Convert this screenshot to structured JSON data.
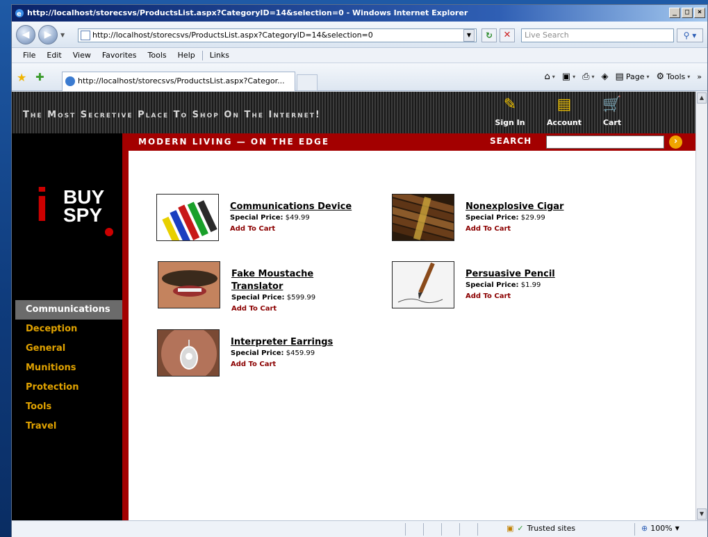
{
  "browser": {
    "title": "http://localhost/storecsvs/ProductsList.aspx?CategoryID=14&selection=0 - Windows Internet Explorer",
    "address": "http://localhost/storecsvs/ProductsList.aspx?CategoryID=14&selection=0",
    "search_placeholder": "Live Search",
    "menu": [
      "File",
      "Edit",
      "View",
      "Favorites",
      "Tools",
      "Help",
      "Links"
    ],
    "tab_label": "http://localhost/storecsvs/ProductsList.aspx?Categor...",
    "commands": {
      "page": "Page",
      "tools": "Tools"
    },
    "status": {
      "zone": "Trusted sites",
      "zoom": "100%"
    }
  },
  "site": {
    "tagline": "The Most Secretive Place To Shop On The Internet!",
    "header_nav": [
      {
        "label": "Sign In",
        "icon": "sign-in-icon"
      },
      {
        "label": "Account",
        "icon": "account-icon"
      },
      {
        "label": "Cart",
        "icon": "cart-icon"
      }
    ],
    "subtitle": "MODERN LIVING — ON THE EDGE",
    "search_label": "SEARCH",
    "logo": {
      "i": "i",
      "buy": "BUY",
      "spy": "SPY"
    },
    "categories": [
      "Communications",
      "Deception",
      "General",
      "Munitions",
      "Protection",
      "Tools",
      "Travel"
    ],
    "active_category": "Communications",
    "price_label": "Special Price:",
    "add_label": "Add To Cart",
    "products": [
      {
        "name": "Communications Device",
        "price": "$49.99",
        "image": "crayons"
      },
      {
        "name": "Nonexplosive Cigar",
        "price": "$29.99",
        "image": "cigars"
      },
      {
        "name": "Fake Moustache Translator",
        "price": "$599.99",
        "image": "moustache"
      },
      {
        "name": "Persuasive Pencil",
        "price": "$1.99",
        "image": "pencil"
      },
      {
        "name": "Interpreter Earrings",
        "price": "$459.99",
        "image": "earring"
      }
    ]
  }
}
